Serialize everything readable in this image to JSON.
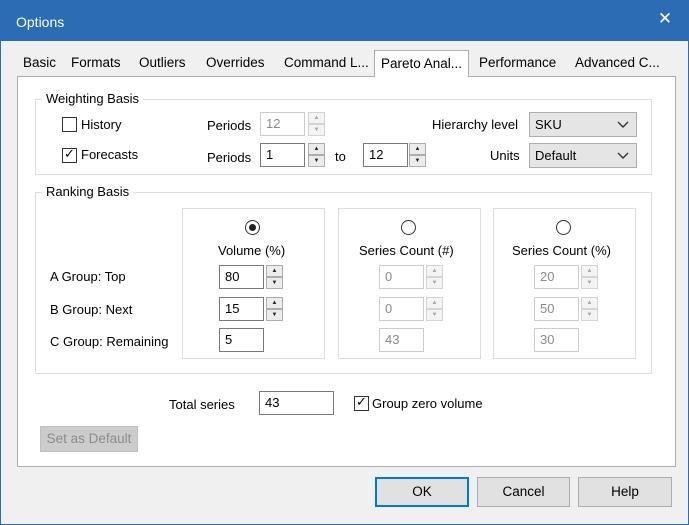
{
  "window": {
    "title": "Options",
    "close_glyph": "✕"
  },
  "tabs": [
    {
      "label": "Basic"
    },
    {
      "label": "Formats"
    },
    {
      "label": "Outliers"
    },
    {
      "label": "Overrides"
    },
    {
      "label": "Command L..."
    },
    {
      "label": "Pareto Anal..."
    },
    {
      "label": "Performance"
    },
    {
      "label": "Advanced C..."
    }
  ],
  "active_tab": "Pareto Anal...",
  "weighting": {
    "title": "Weighting Basis",
    "history": {
      "label": "History",
      "checked": false,
      "periods_label": "Periods",
      "periods_value": "12"
    },
    "forecasts": {
      "label": "Forecasts",
      "checked": true,
      "periods_label": "Periods",
      "periods_from": "1",
      "to_label": "to",
      "periods_to": "12"
    },
    "hierarchy": {
      "label": "Hierarchy level",
      "value": "SKU"
    },
    "units": {
      "label": "Units",
      "value": "Default"
    }
  },
  "ranking": {
    "title": "Ranking Basis",
    "rows": [
      {
        "label": "A Group: Top"
      },
      {
        "label": "B Group: Next"
      },
      {
        "label": "C Group: Remaining"
      }
    ],
    "columns": [
      {
        "header": "Volume (%)",
        "selected": true,
        "values": [
          "80",
          "15",
          "5"
        ]
      },
      {
        "header": "Series Count (#)",
        "selected": false,
        "values": [
          "0",
          "0",
          "43"
        ]
      },
      {
        "header": "Series Count (%)",
        "selected": false,
        "values": [
          "20",
          "50",
          "30"
        ]
      }
    ]
  },
  "total_series": {
    "label": "Total series",
    "value": "43"
  },
  "group_zero_volume": {
    "label": "Group zero volume",
    "checked": true
  },
  "buttons": {
    "set_default": "Set as Default",
    "ok": "OK",
    "cancel": "Cancel",
    "help": "Help"
  },
  "icons": {
    "checkmark": "✓",
    "spin_up": "▲",
    "spin_down": "▼",
    "dropdown": "chevron-down-icon"
  },
  "colors": {
    "title_bar": "#2b6cb5",
    "default_button_border": "#0078d7"
  }
}
